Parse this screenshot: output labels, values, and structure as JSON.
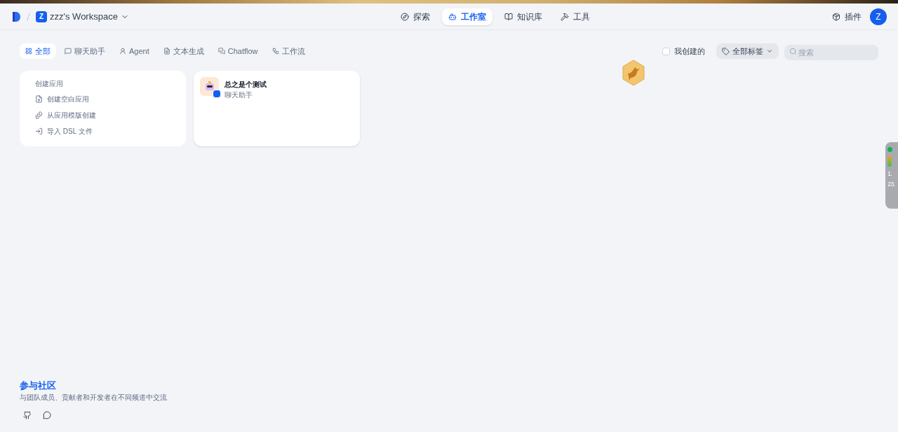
{
  "header": {
    "workspace": {
      "initial": "Z",
      "name": "zzz's Workspace"
    },
    "nav": [
      {
        "kind": "explore",
        "label": "探索",
        "selected": false
      },
      {
        "kind": "studio",
        "label": "工作室",
        "selected": true
      },
      {
        "kind": "knowledge",
        "label": "知识库",
        "selected": false
      },
      {
        "kind": "tools",
        "label": "工具",
        "selected": false
      }
    ],
    "plugins": "插件",
    "avatar": "Z"
  },
  "filters": [
    {
      "kind": "all",
      "label": "全部",
      "selected": true
    },
    {
      "kind": "chat",
      "label": "聊天助手",
      "selected": false
    },
    {
      "kind": "agent",
      "label": "Agent",
      "selected": false
    },
    {
      "kind": "text",
      "label": "文本生成",
      "selected": false
    },
    {
      "kind": "chatflow",
      "label": "Chatflow",
      "selected": false
    },
    {
      "kind": "workflow",
      "label": "工作流",
      "selected": false
    }
  ],
  "mine": {
    "label": "我创建的",
    "checked": false
  },
  "tags": "全部标签",
  "search": {
    "placeholder": "搜索"
  },
  "create": {
    "title": "创建应用",
    "actions": [
      {
        "kind": "blank",
        "label": "创建空白应用"
      },
      {
        "kind": "template",
        "label": "从应用模版创建"
      },
      {
        "kind": "import",
        "label": "导入 DSL 文件"
      }
    ]
  },
  "apps": [
    {
      "name": "总之是个测试",
      "type": "聊天助手"
    }
  ],
  "community": {
    "title": "参与社区",
    "text": "与团队成员、贡献者和开发者在不同频道中交流"
  },
  "widget": [
    "1.",
    "23."
  ]
}
